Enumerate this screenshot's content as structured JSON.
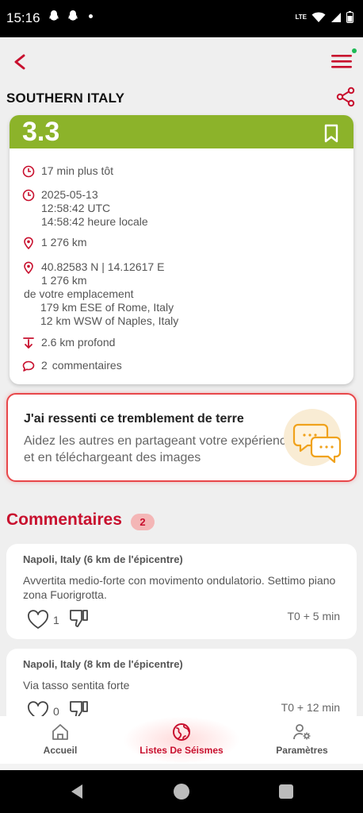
{
  "status_bar": {
    "time": "15:16",
    "network": "LTE"
  },
  "header": {
    "region": "SOUTHERN ITALY"
  },
  "quake": {
    "magnitude": "3.3",
    "relative_time": "17 min plus tôt",
    "date": "2025-05-13",
    "time_utc": "12:58:42 UTC",
    "time_local": "14:58:42 heure locale",
    "distance": "1 276 km",
    "coordinates": "40.82583 N | 14.12617 E",
    "distance_again": "1 276 km",
    "from_location_label": "de votre emplacement",
    "nearby_1": "179 km ESE of Rome, Italy",
    "nearby_2": "12 km WSW of Naples, Italy",
    "depth": "2.6 km profond",
    "comments_count": "2",
    "comments_label": "commentaires",
    "colors": {
      "magnitude_bg": "#8cb32a",
      "accent": "#c8102e"
    }
  },
  "felt": {
    "title": "J'ai ressenti ce tremblement de terre",
    "subtitle": "Aidez les autres en partageant votre expérience et en téléchargeant des images"
  },
  "comments": {
    "title": "Commentaires",
    "count": "2",
    "items": [
      {
        "location": "Napoli, Italy (6 km de l'épicentre)",
        "text": "Avvertita medio-forte con movimento ondulatorio. Settimo piano zona Fuorigrotta.",
        "likes": "1",
        "time": "T0 + 5 min"
      },
      {
        "location": "Napoli, Italy (8 km de l'épicentre)",
        "text": "Via tasso sentita forte",
        "likes": "0",
        "time": "T0 + 12 min"
      }
    ]
  },
  "bottom_nav": {
    "home": "Accueil",
    "list": "Listes De Séismes",
    "settings": "Paramètres"
  }
}
